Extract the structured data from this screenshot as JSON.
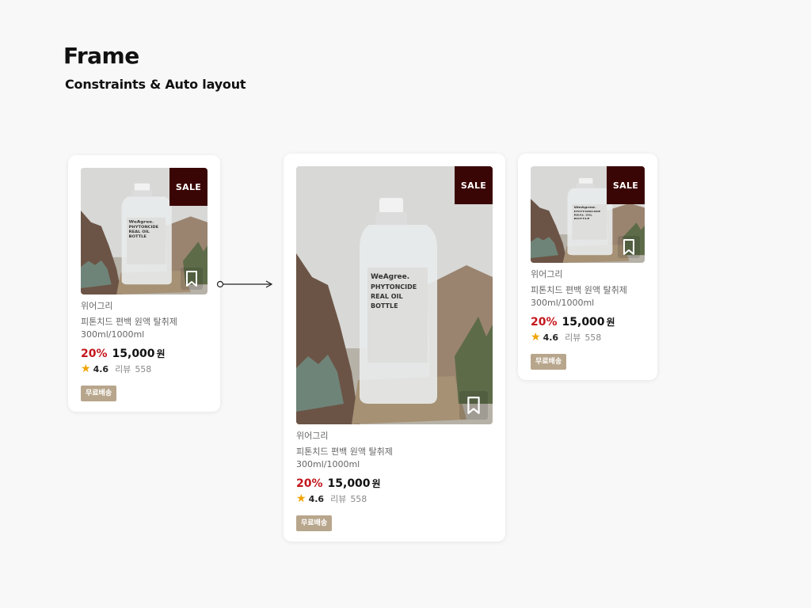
{
  "page": {
    "title": "Frame",
    "subtitle": "Constraints & Auto layout"
  },
  "colors": {
    "sale_badge": "#3a0605",
    "discount": "#c4161c",
    "star": "#f0a400",
    "shipping_tag": "#b8a68c",
    "background": "#f8f8f8"
  },
  "product": {
    "image_label_lines": [
      "WeAgree.",
      "PHYTONCIDE",
      "REAL OIL",
      "BOTTLE"
    ],
    "sale_badge": "SALE",
    "bookmark_icon": "bookmark-icon",
    "brand": "위어그리",
    "name": "피톤치드 편백 원액 탈취제",
    "volume": "300ml/1000ml",
    "discount": "20%",
    "price": "15,000",
    "currency": "원",
    "star_icon": "star-icon",
    "rating": "4.6",
    "review_label": "리뷰",
    "review_count": "558",
    "shipping_tag": "무료배송"
  },
  "cards": [
    {
      "id": "card-original"
    },
    {
      "id": "card-scaled"
    },
    {
      "id": "card-constrained"
    }
  ]
}
